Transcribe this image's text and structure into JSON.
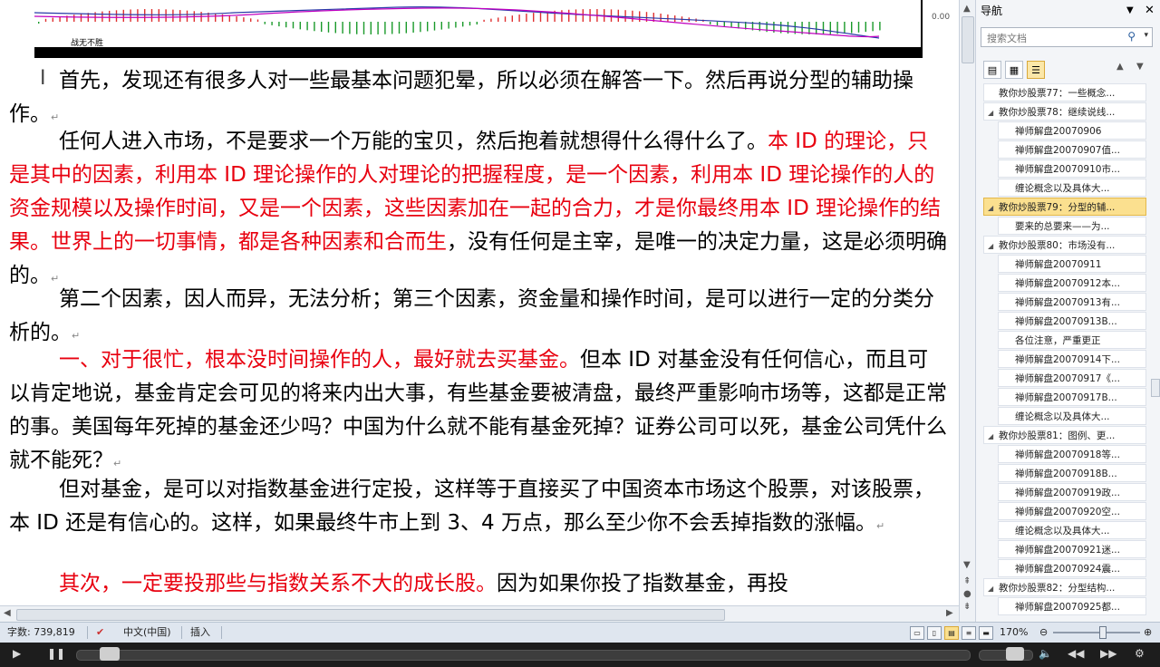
{
  "chart_embed": {
    "caption": "战无不胜",
    "zero_label": "0.00"
  },
  "paragraphs": [
    {
      "runs": [
        {
          "text": "首先，发现还有很多人对一些最基本问题犯晕，所以必须在解答一下。然后再说分型的辅助操作。",
          "red": false
        }
      ],
      "mark": "↵"
    },
    {
      "runs": [
        {
          "text": "任何人进入市场，不是要求一个万能的宝贝，然后抱着就想得什么得什么了。",
          "red": false
        },
        {
          "text": "本 ID 的理论，只是其中的因素，利用本 ID 理论操作的人对理论的把握程度，是一个因素，利用本 ID 理论操作的人的资金规模以及操作时间，又是一个因素，这些因素加在一起的合力，才是你最终用本 ID 理论操作的结果。世界上的一切事情，都是各种因素和合而生",
          "red": true
        },
        {
          "text": "，没有任何是主宰，是唯一的决定力量，这是必须明确的。",
          "red": false
        }
      ],
      "mark": "↵"
    },
    {
      "runs": [
        {
          "text": "第二个因素，因人而异，无法分析；第三个因素，资金量和操作时间，是可以进行一定的分类分析的。",
          "red": false
        }
      ],
      "mark": "↵"
    },
    {
      "runs": [
        {
          "text": "一、对于很忙，根本没时间操作的人，最好就去买基金。",
          "red": true
        },
        {
          "text": "但本 ID 对基金没有任何信心，而且可以肯定地说，基金肯定会可见的将来内出大事，有些基金要被清盘，最终严重影响市场等，这都是正常的事。美国每年死掉的基金还少吗？中国为什么就不能有基金死掉？证券公司可以死，基金公司凭什么就不能死？",
          "red": false
        }
      ],
      "mark": "↵"
    },
    {
      "runs": [
        {
          "text": "但对基金，是可以对指数基金进行定投，这样等于直接买了中国资本市场这个股票，对该股票，本 ID 还是有信心的。这样，如果最终牛市上到 3、4 万点，那么至少你不会丢掉指数的涨幅。",
          "red": false
        }
      ],
      "mark": "↵"
    },
    {
      "runs": [
        {
          "text": "其次，一定要投那些与指数关系不大的成长股。",
          "red": true
        },
        {
          "text": "因为如果你投了指数基金，再投",
          "red": false
        }
      ],
      "mark": ""
    }
  ],
  "nav": {
    "title": "导航",
    "search_placeholder": "搜索文档",
    "items": [
      {
        "label": "教你炒股票77：一些概念...",
        "level": 1,
        "expanded": false,
        "selected": false
      },
      {
        "label": "教你炒股票78：继续说线...",
        "level": 1,
        "expanded": true,
        "selected": false
      },
      {
        "label": "禅师解盘20070906",
        "level": 2,
        "selected": false
      },
      {
        "label": "禅师解盘20070907值...",
        "level": 2,
        "selected": false
      },
      {
        "label": "禅师解盘20070910市...",
        "level": 2,
        "selected": false
      },
      {
        "label": "缠论概念以及具体大...",
        "level": 2,
        "selected": false
      },
      {
        "label": "教你炒股票79：分型的辅...",
        "level": 1,
        "expanded": true,
        "selected": true
      },
      {
        "label": "要来的总要来——为...",
        "level": 2,
        "selected": false
      },
      {
        "label": "教你炒股票80：市场没有...",
        "level": 1,
        "expanded": true,
        "selected": false
      },
      {
        "label": "禅师解盘20070911",
        "level": 2,
        "selected": false
      },
      {
        "label": "禅师解盘20070912本...",
        "level": 2,
        "selected": false
      },
      {
        "label": "禅师解盘20070913有...",
        "level": 2,
        "selected": false
      },
      {
        "label": "禅师解盘20070913B...",
        "level": 2,
        "selected": false
      },
      {
        "label": "各位注意，严重更正",
        "level": 2,
        "selected": false
      },
      {
        "label": "禅师解盘20070914下...",
        "level": 2,
        "selected": false
      },
      {
        "label": "禅师解盘20070917《...",
        "level": 2,
        "selected": false
      },
      {
        "label": "禅师解盘20070917B...",
        "level": 2,
        "selected": false
      },
      {
        "label": "缠论概念以及具体大...",
        "level": 2,
        "selected": false
      },
      {
        "label": "教你炒股票81：图例、更...",
        "level": 1,
        "expanded": true,
        "selected": false
      },
      {
        "label": "禅师解盘20070918等...",
        "level": 2,
        "selected": false
      },
      {
        "label": "禅师解盘20070918B...",
        "level": 2,
        "selected": false
      },
      {
        "label": "禅师解盘20070919政...",
        "level": 2,
        "selected": false
      },
      {
        "label": "禅师解盘20070920空...",
        "level": 2,
        "selected": false
      },
      {
        "label": "缠论概念以及具体大...",
        "level": 2,
        "selected": false
      },
      {
        "label": "禅师解盘20070921迷...",
        "level": 2,
        "selected": false
      },
      {
        "label": "禅师解盘20070924震...",
        "level": 2,
        "selected": false
      },
      {
        "label": "教你炒股票82：分型结构...",
        "level": 1,
        "expanded": true,
        "selected": false
      },
      {
        "label": "禅师解盘20070925都...",
        "level": 2,
        "selected": false
      }
    ]
  },
  "status": {
    "word_count": "字数: 739,819",
    "language": "中文(中国)",
    "mode": "插入",
    "zoom": "170%"
  },
  "icons": {
    "search": "search-icon",
    "close": "close-icon",
    "dropdown": "chevron-down-icon",
    "play": "play-icon",
    "pause": "pause-icon",
    "volume": "volume-icon"
  }
}
